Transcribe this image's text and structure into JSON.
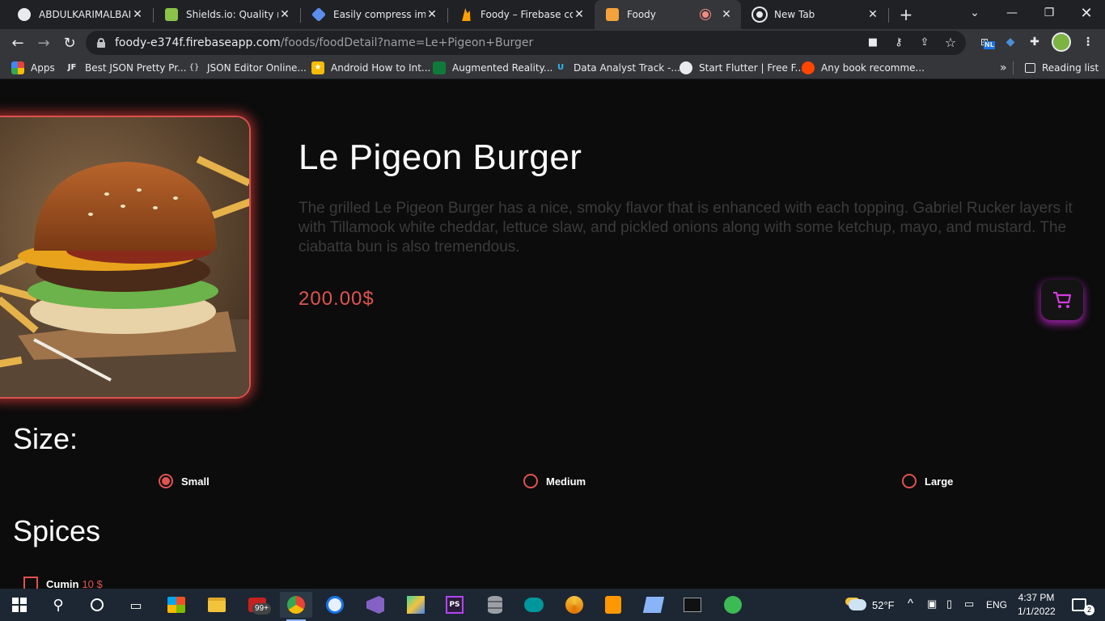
{
  "browser": {
    "tabs": [
      {
        "title": "ABDULKARIMALBAIK/",
        "icon": "github-icon"
      },
      {
        "title": "Shields.io: Quality met",
        "icon": "shields-icon"
      },
      {
        "title": "Easily compress image",
        "icon": "compress-icon"
      },
      {
        "title": "Foody – Firebase cons",
        "icon": "firebase-icon"
      },
      {
        "title": "Foody",
        "icon": "foody-icon",
        "active": true
      },
      {
        "title": "New Tab",
        "icon": "chrome-icon"
      }
    ],
    "url_host": "foody-e374f.firebaseapp.com",
    "url_path": "/foods/foodDetail?name=Le+Pigeon+Burger",
    "bookmarks": [
      {
        "label": "Apps",
        "icon": "apps-grid-icon"
      },
      {
        "label": "Best JSON Pretty Pr...",
        "icon": "jf-icon"
      },
      {
        "label": "JSON Editor Online...",
        "icon": "json-braces-icon"
      },
      {
        "label": "Android How to Int...",
        "icon": "android-icon"
      },
      {
        "label": "Augmented Reality...",
        "icon": "ar-icon"
      },
      {
        "label": "Data Analyst Track -...",
        "icon": "udacity-icon"
      },
      {
        "label": "Start Flutter | Free F...",
        "icon": "globe-icon"
      },
      {
        "label": "Any book recomme...",
        "icon": "reddit-icon"
      }
    ],
    "more_bookmarks": "»",
    "reading_list": "Reading list",
    "extension_badge": "NL"
  },
  "page": {
    "title": "Le Pigeon Burger",
    "description": "The grilled Le Pigeon Burger has a nice, smoky flavor that is enhanced with each topping. Gabriel Rucker layers it with Tillamook white cheddar, lettuce slaw, and pickled onions along with some ketchup, mayo, and mustard. The ciabatta bun is also tremendous.",
    "price": "200.00$",
    "size_heading": "Size:",
    "sizes": [
      {
        "label": "Small",
        "selected": true
      },
      {
        "label": "Medium",
        "selected": false
      },
      {
        "label": "Large",
        "selected": false
      }
    ],
    "spices_heading": "Spices",
    "spices": [
      {
        "label": "Cumin",
        "price": "10 $",
        "checked": false
      }
    ],
    "colors": {
      "accent": "#e0534e",
      "cart_glow": "#cd28dc",
      "background": "#0c0c0c"
    }
  },
  "taskbar": {
    "weather": "52°F",
    "language": "ENG",
    "time": "4:37 PM",
    "date": "1/1/2022",
    "mail_badge": "99+",
    "notification_count": "2"
  }
}
